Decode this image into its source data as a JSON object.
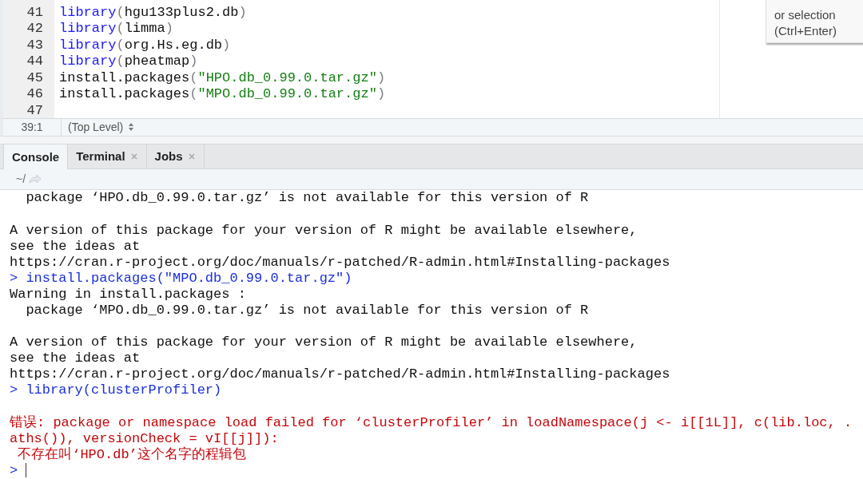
{
  "editor": {
    "lines": [
      {
        "number": "41",
        "tokens": [
          {
            "kind": "function",
            "text": "library"
          },
          {
            "kind": "punct",
            "text": "("
          },
          {
            "kind": "plain",
            "text": "hgu133plus2.db"
          },
          {
            "kind": "punct",
            "text": ")"
          }
        ]
      },
      {
        "number": "42",
        "tokens": [
          {
            "kind": "function",
            "text": "library"
          },
          {
            "kind": "punct",
            "text": "("
          },
          {
            "kind": "plain",
            "text": "limma"
          },
          {
            "kind": "punct",
            "text": ")"
          }
        ]
      },
      {
        "number": "43",
        "tokens": [
          {
            "kind": "function",
            "text": "library"
          },
          {
            "kind": "punct",
            "text": "("
          },
          {
            "kind": "plain",
            "text": "org.Hs.eg.db"
          },
          {
            "kind": "punct",
            "text": ")"
          }
        ]
      },
      {
        "number": "44",
        "tokens": [
          {
            "kind": "function",
            "text": "library"
          },
          {
            "kind": "punct",
            "text": "("
          },
          {
            "kind": "plain",
            "text": "pheatmap"
          },
          {
            "kind": "punct",
            "text": ")"
          }
        ]
      },
      {
        "number": "45",
        "tokens": [
          {
            "kind": "plain",
            "text": "install.packages"
          },
          {
            "kind": "punct",
            "text": "("
          },
          {
            "kind": "string",
            "text": "\"HPO.db_0.99.0.tar.gz\""
          },
          {
            "kind": "punct",
            "text": ")"
          }
        ]
      },
      {
        "number": "46",
        "tokens": [
          {
            "kind": "plain",
            "text": "install.packages"
          },
          {
            "kind": "punct",
            "text": "("
          },
          {
            "kind": "string",
            "text": "\"MPO.db_0.99.0.tar.gz\""
          },
          {
            "kind": "punct",
            "text": ")"
          }
        ]
      },
      {
        "number": "47"
      }
    ]
  },
  "tooltip": {
    "lines": [
      "or selection",
      "(Ctrl+Enter)"
    ]
  },
  "status_bar": {
    "position": "39:1",
    "scope": "(Top Level)"
  },
  "tabs": [
    {
      "label": "Console",
      "selected": true,
      "closable": false
    },
    {
      "label": "Terminal",
      "selected": false,
      "closable": true
    },
    {
      "label": "Jobs",
      "selected": false,
      "closable": true
    }
  ],
  "console": {
    "path": "~/",
    "lines": [
      {
        "kind": "output",
        "text": "  package ‘HPO.db_0.99.0.tar.gz’ is not available for this version of R"
      },
      {
        "kind": "blank"
      },
      {
        "kind": "output",
        "text": "A version of this package for your version of R might be available elsewhere,"
      },
      {
        "kind": "output",
        "text": "see the ideas at"
      },
      {
        "kind": "output",
        "text": "https://cran.r-project.org/doc/manuals/r-patched/R-admin.html#Installing-packages"
      },
      {
        "kind": "input",
        "prompt": ">",
        "text": "install.packages(\"MPO.db_0.99.0.tar.gz\")"
      },
      {
        "kind": "output",
        "text": "Warning in install.packages :"
      },
      {
        "kind": "output",
        "text": "  package ‘MPO.db_0.99.0.tar.gz’ is not available for this version of R"
      },
      {
        "kind": "blank"
      },
      {
        "kind": "output",
        "text": "A version of this package for your version of R might be available elsewhere,"
      },
      {
        "kind": "output",
        "text": "see the ideas at"
      },
      {
        "kind": "output",
        "text": "https://cran.r-project.org/doc/manuals/r-patched/R-admin.html#Installing-packages"
      },
      {
        "kind": "input",
        "prompt": ">",
        "text": "library(clusterProfiler)"
      },
      {
        "kind": "blank"
      },
      {
        "kind": "error",
        "text": "错误: package or namespace load failed for ‘clusterProfiler’ in loadNamespace(j <- i[[1L]], c(lib.loc, ."
      },
      {
        "kind": "error",
        "text": "aths()), versionCheck = vI[[j]]):"
      },
      {
        "kind": "error",
        "text": " 不存在叫‘HPO.db’这个名字的程辑包"
      },
      {
        "kind": "prompt",
        "prompt": ">"
      }
    ]
  }
}
